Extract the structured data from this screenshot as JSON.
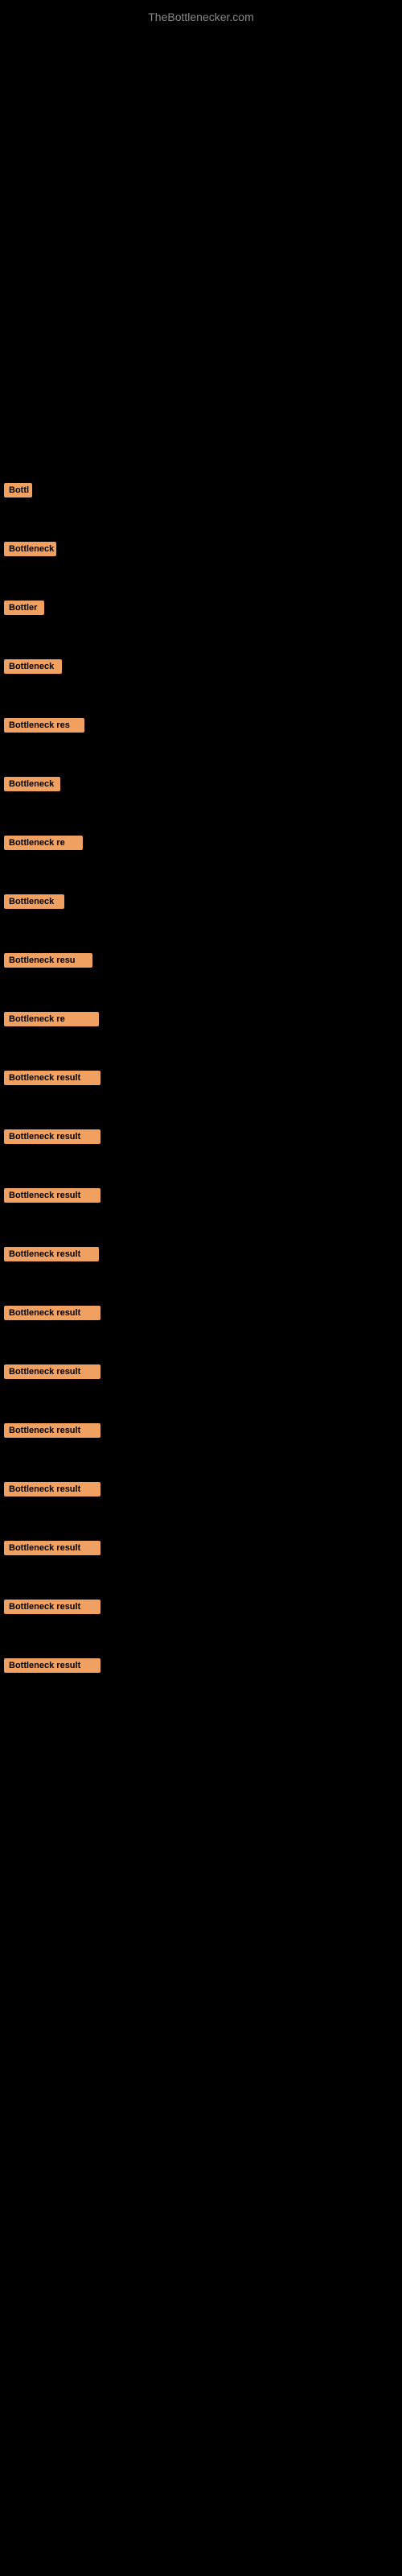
{
  "site": {
    "title": "TheBottlenecker.com"
  },
  "items": [
    {
      "id": 1,
      "label": "Bottleneck result",
      "display": "Bottl"
    },
    {
      "id": 2,
      "label": "Bottleneck result",
      "display": "Bottleneck"
    },
    {
      "id": 3,
      "label": "Bottleneck result",
      "display": "Bottler"
    },
    {
      "id": 4,
      "label": "Bottleneck result",
      "display": "Bottleneck"
    },
    {
      "id": 5,
      "label": "Bottleneck result",
      "display": "Bottleneck res"
    },
    {
      "id": 6,
      "label": "Bottleneck result",
      "display": "Bottleneck"
    },
    {
      "id": 7,
      "label": "Bottleneck result",
      "display": "Bottleneck re"
    },
    {
      "id": 8,
      "label": "Bottleneck result",
      "display": "Bottleneck"
    },
    {
      "id": 9,
      "label": "Bottleneck result",
      "display": "Bottleneck resu"
    },
    {
      "id": 10,
      "label": "Bottleneck result",
      "display": "Bottleneck re"
    },
    {
      "id": 11,
      "label": "Bottleneck result",
      "display": "Bottleneck result"
    },
    {
      "id": 12,
      "label": "Bottleneck result",
      "display": "Bottleneck result"
    },
    {
      "id": 13,
      "label": "Bottleneck result",
      "display": "Bottleneck result"
    },
    {
      "id": 14,
      "label": "Bottleneck result",
      "display": "Bottleneck result"
    },
    {
      "id": 15,
      "label": "Bottleneck result",
      "display": "Bottleneck result"
    },
    {
      "id": 16,
      "label": "Bottleneck result",
      "display": "Bottleneck result"
    },
    {
      "id": 17,
      "label": "Bottleneck result",
      "display": "Bottleneck result"
    },
    {
      "id": 18,
      "label": "Bottleneck result",
      "display": "Bottleneck result"
    },
    {
      "id": 19,
      "label": "Bottleneck result",
      "display": "Bottleneck result"
    },
    {
      "id": 20,
      "label": "Bottleneck result",
      "display": "Bottleneck result"
    },
    {
      "id": 21,
      "label": "Bottleneck result",
      "display": "Bottleneck result"
    }
  ]
}
